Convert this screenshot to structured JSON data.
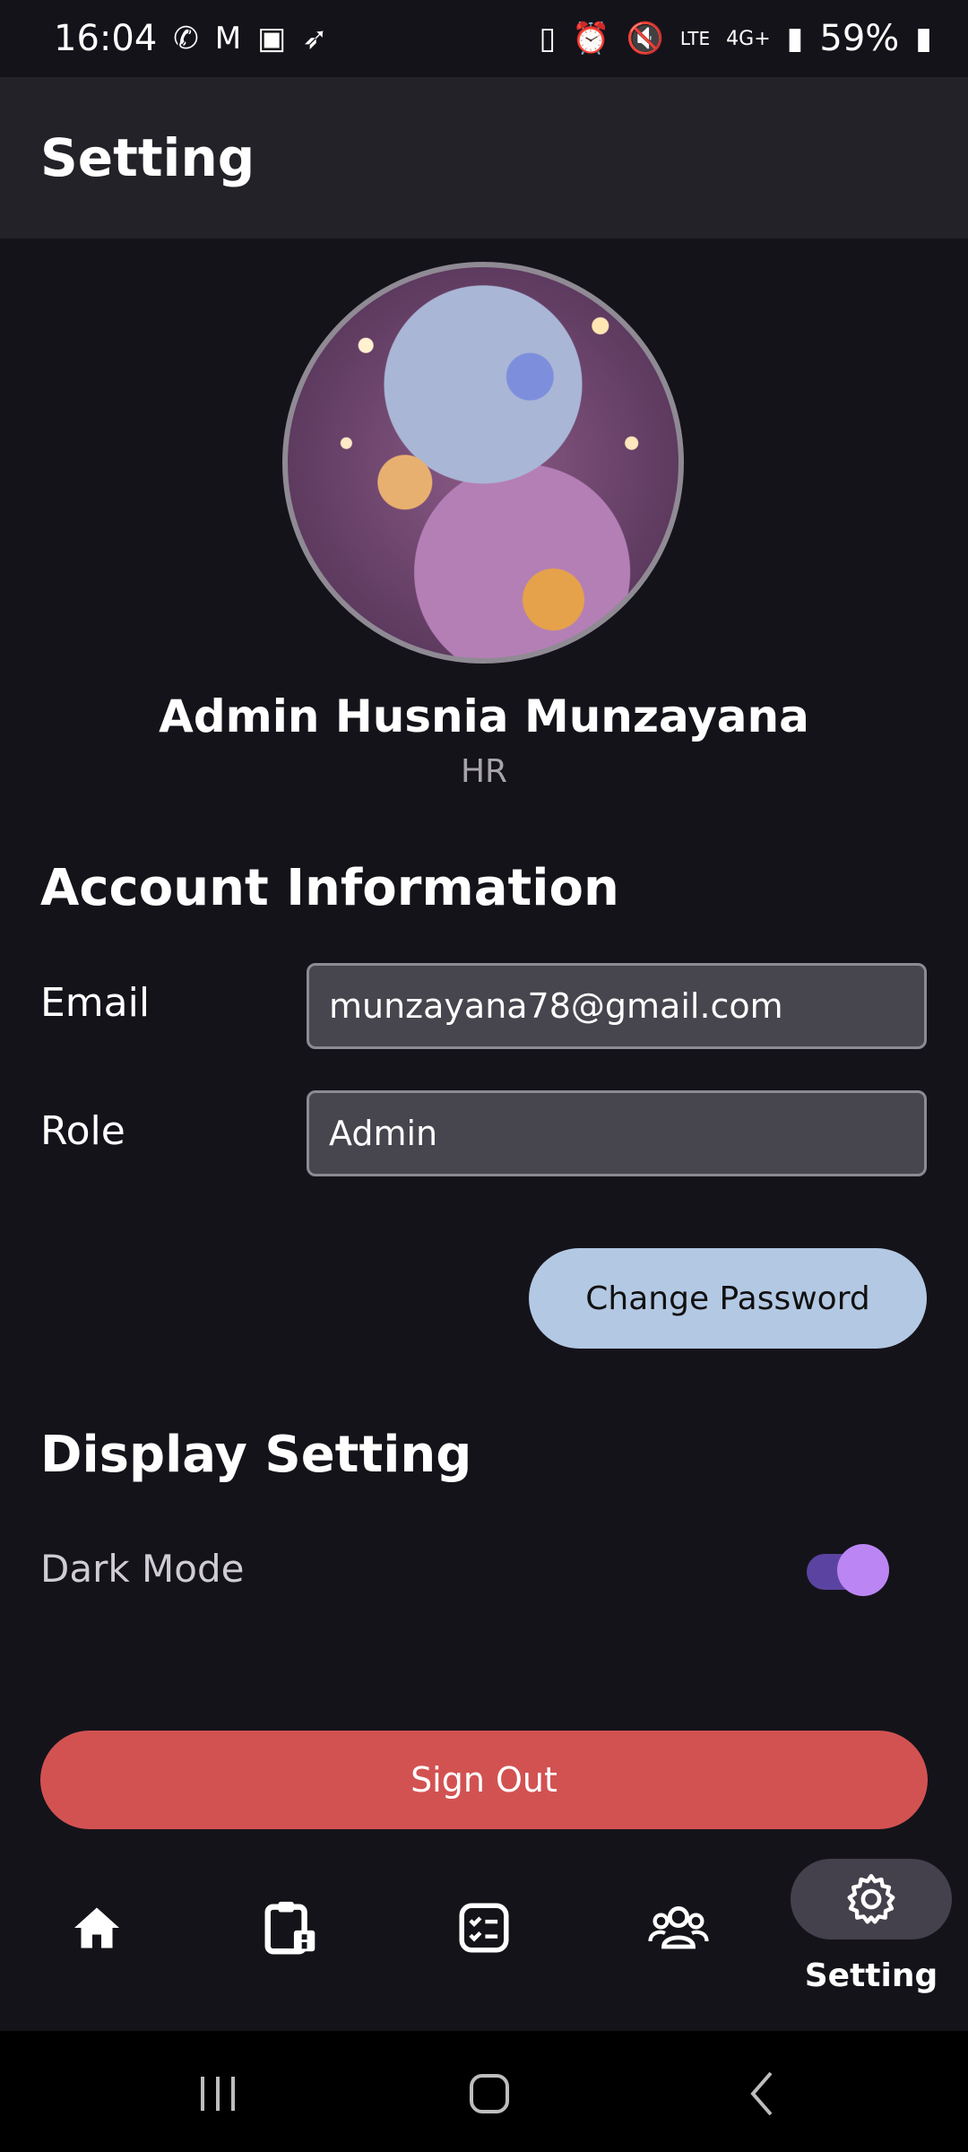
{
  "status_bar": {
    "time": "16:04",
    "battery": "59%",
    "network": "4G+",
    "left_icons": [
      "whatsapp-icon",
      "gmail-icon",
      "gallery-icon",
      "bird-icon"
    ],
    "right_icons": [
      "battery-saver-icon",
      "alarm-icon",
      "mute-icon",
      "volte-icon",
      "signal-icon",
      "battery-icon"
    ]
  },
  "app_bar": {
    "title": "Setting"
  },
  "profile": {
    "name": "Admin Husnia Munzayana",
    "role": "HR"
  },
  "account": {
    "title": "Account Information",
    "email_label": "Email",
    "email_value": "munzayana78@gmail.com",
    "role_label": "Role",
    "role_value": "Admin",
    "change_password_label": "Change Password"
  },
  "display": {
    "title": "Display Setting",
    "dark_mode_label": "Dark Mode",
    "dark_mode_on": true
  },
  "sign_out_label": "Sign Out",
  "bottom_nav": {
    "items": [
      "home-icon",
      "leave-request-icon",
      "task-list-icon",
      "employees-icon",
      "settings-icon"
    ],
    "active_label": "Setting"
  },
  "colors": {
    "background": "#15131a",
    "app_bar": "#232228",
    "accent_toggle": "#bb86f4",
    "sign_out": "#d25252",
    "password_button": "#b3c8e3"
  }
}
